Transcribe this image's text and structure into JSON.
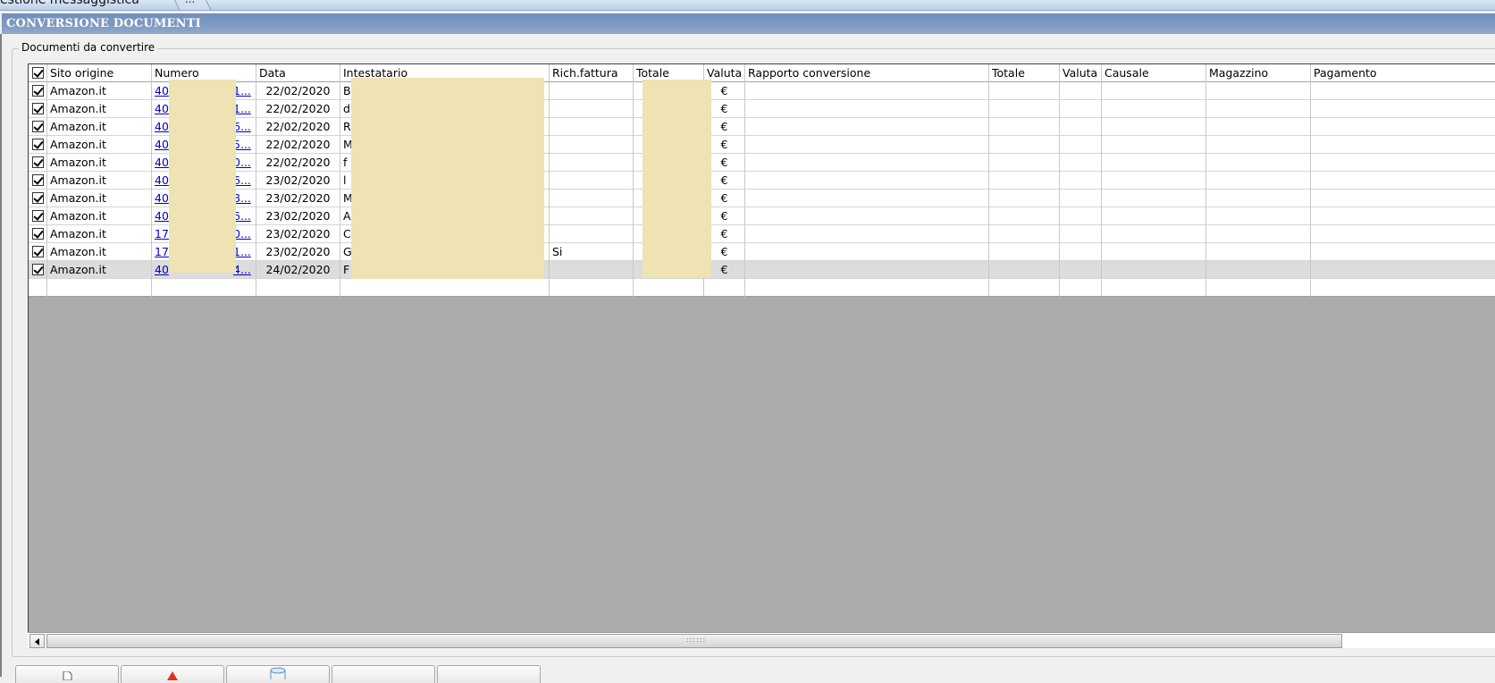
{
  "window": {
    "tab_title": "estione messaggistica",
    "tab_more": "...",
    "panel_title": "CONVERSIONE DOCUMENTI"
  },
  "group": {
    "label": "Documenti da convertire"
  },
  "grid": {
    "columns": [
      "Sito origine",
      "Numero",
      "Data",
      "Intestatario",
      "Rich.fattura",
      "Totale",
      "Valuta",
      "Rapporto conversione",
      "Totale",
      "Valuta",
      "Causale",
      "Magazzino",
      "Pagamento"
    ],
    "rows": [
      {
        "checked": true,
        "sito": "Amazon.it",
        "numero_start": "40",
        "numero_end": "1...",
        "data": "22/02/2020",
        "intestatario": "B",
        "rich_fattura": "",
        "valuta": "€"
      },
      {
        "checked": true,
        "sito": "Amazon.it",
        "numero_start": "40",
        "numero_end": "1...",
        "data": "22/02/2020",
        "intestatario": "d",
        "rich_fattura": "",
        "valuta": "€"
      },
      {
        "checked": true,
        "sito": "Amazon.it",
        "numero_start": "40",
        "numero_end": "6...",
        "data": "22/02/2020",
        "intestatario": "R",
        "rich_fattura": "",
        "valuta": "€"
      },
      {
        "checked": true,
        "sito": "Amazon.it",
        "numero_start": "40",
        "numero_end": "5...",
        "data": "22/02/2020",
        "intestatario": "M",
        "rich_fattura": "",
        "valuta": "€"
      },
      {
        "checked": true,
        "sito": "Amazon.it",
        "numero_start": "40",
        "numero_end": "0...",
        "data": "22/02/2020",
        "intestatario": "f",
        "rich_fattura": "",
        "valuta": "€"
      },
      {
        "checked": true,
        "sito": "Amazon.it",
        "numero_start": "40",
        "numero_end": "6...",
        "data": "23/02/2020",
        "intestatario": "l",
        "rich_fattura": "",
        "valuta": "€"
      },
      {
        "checked": true,
        "sito": "Amazon.it",
        "numero_start": "40",
        "numero_end": "8...",
        "data": "23/02/2020",
        "intestatario": "M",
        "rich_fattura": "",
        "valuta": "€"
      },
      {
        "checked": true,
        "sito": "Amazon.it",
        "numero_start": "40",
        "numero_end": "6...",
        "data": "23/02/2020",
        "intestatario": "A",
        "rich_fattura": "",
        "valuta": "€"
      },
      {
        "checked": true,
        "sito": "Amazon.it",
        "numero_start": "17",
        "numero_end": "0...",
        "data": "23/02/2020",
        "intestatario": "C",
        "rich_fattura": "",
        "valuta": "€"
      },
      {
        "checked": true,
        "sito": "Amazon.it",
        "numero_start": "17",
        "numero_end": "1...",
        "data": "23/02/2020",
        "intestatario": "G",
        "rich_fattura": "Si",
        "valuta": "€"
      },
      {
        "checked": true,
        "sito": "Amazon.it",
        "numero_start": "40",
        "numero_end": "4...",
        "data": "24/02/2020",
        "intestatario": "F",
        "rich_fattura": "",
        "valuta": "€",
        "selected": true
      }
    ]
  },
  "colors": {
    "title_bar": "#7f9bc2",
    "grid_empty_area": "#ababab",
    "redaction": "#efe2b3",
    "link": "#0000cc"
  }
}
